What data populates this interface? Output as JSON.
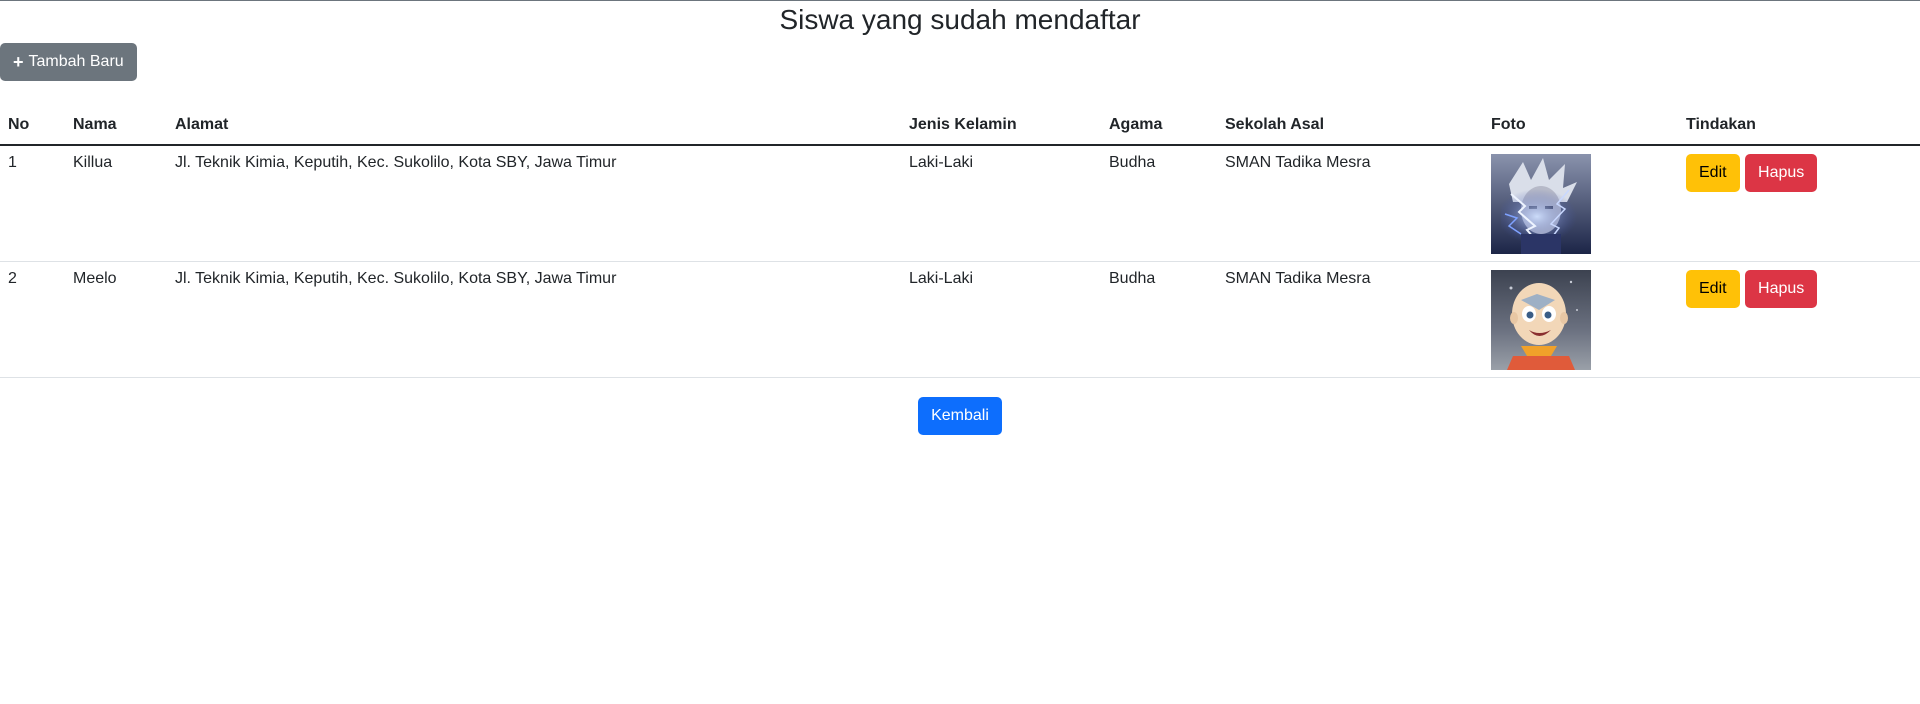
{
  "header": {
    "title": "Siswa yang sudah mendaftar",
    "add_label": "Tambah Baru"
  },
  "table": {
    "columns": [
      "No",
      "Nama",
      "Alamat",
      "Jenis Kelamin",
      "Agama",
      "Sekolah Asal",
      "Foto",
      "Tindakan"
    ],
    "rows": [
      {
        "no": "1",
        "nama": "Killua",
        "alamat": "Jl. Teknik Kimia, Keputih, Kec. Sukolilo, Kota SBY, Jawa Timur",
        "jenis_kelamin": "Laki-Laki",
        "agama": "Budha",
        "sekolah_asal": "SMAN Tadika Mesra",
        "edit_label": "Edit",
        "delete_label": "Hapus"
      },
      {
        "no": "2",
        "nama": "Meelo",
        "alamat": "Jl. Teknik Kimia, Keputih, Kec. Sukolilo, Kota SBY, Jawa Timur",
        "jenis_kelamin": "Laki-Laki",
        "agama": "Budha",
        "sekolah_asal": "SMAN Tadika Mesra",
        "edit_label": "Edit",
        "delete_label": "Hapus"
      }
    ]
  },
  "footer": {
    "back_label": "Kembali"
  },
  "colors": {
    "secondary": "#6c757d",
    "warning": "#ffc107",
    "danger": "#dc3545",
    "primary": "#0d6efd"
  }
}
